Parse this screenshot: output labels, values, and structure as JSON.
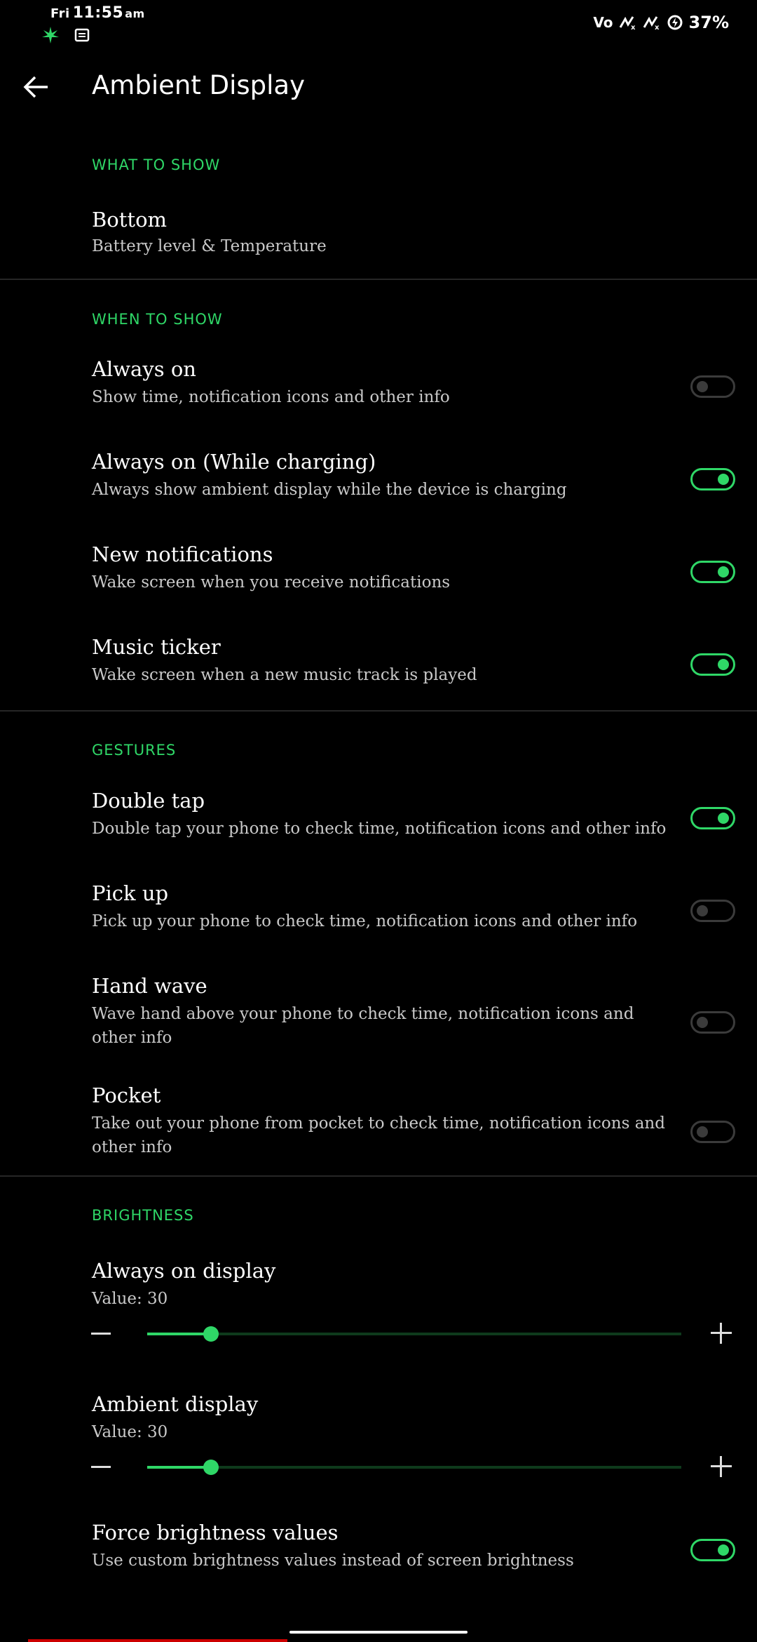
{
  "status_bar": {
    "day": "Fri",
    "time": "11:55",
    "ampm": "am",
    "carrier_indicator": "Vo",
    "battery": "37%"
  },
  "app_bar": {
    "title": "Ambient Display"
  },
  "sections": {
    "what": {
      "header": "WHAT TO SHOW",
      "bottom": {
        "title": "Bottom",
        "subtitle": "Battery level & Temperature"
      }
    },
    "when": {
      "header": "WHEN TO SHOW",
      "always_on": {
        "title": "Always on",
        "subtitle": "Show time, notification icons and other info",
        "enabled": false
      },
      "always_on_charging": {
        "title": "Always on (While charging)",
        "subtitle": "Always show ambient display while the device is charging",
        "enabled": true
      },
      "new_notifications": {
        "title": "New notifications",
        "subtitle": "Wake screen when you receive notifications",
        "enabled": true
      },
      "music_ticker": {
        "title": "Music ticker",
        "subtitle": "Wake screen when a new music track is played",
        "enabled": true
      }
    },
    "gestures": {
      "header": "GESTURES",
      "double_tap": {
        "title": "Double tap",
        "subtitle": "Double tap your phone to check time, notification icons and other info",
        "enabled": true
      },
      "pick_up": {
        "title": "Pick up",
        "subtitle": "Pick up your phone to check time, notification icons and other info",
        "enabled": false
      },
      "hand_wave": {
        "title": "Hand wave",
        "subtitle": "Wave hand above your phone to check time, notification icons and other info",
        "enabled": false
      },
      "pocket": {
        "title": "Pocket",
        "subtitle": "Take out your phone from pocket to check time, notification icons and other info",
        "enabled": false
      }
    },
    "brightness": {
      "header": "BRIGHTNESS",
      "always_on_display": {
        "title": "Always on display",
        "value_label": "Value: 30",
        "value_fraction": 0.12
      },
      "ambient_display": {
        "title": "Ambient display",
        "value_label": "Value: 30",
        "value_fraction": 0.12
      },
      "force_values": {
        "title": "Force brightness values",
        "subtitle": "Use custom brightness values instead of screen brightness",
        "enabled": true
      }
    }
  },
  "colors": {
    "accent": "#2fd767",
    "background": "#000000",
    "divider": "#262626",
    "switch_off": "#3b3b3b"
  }
}
